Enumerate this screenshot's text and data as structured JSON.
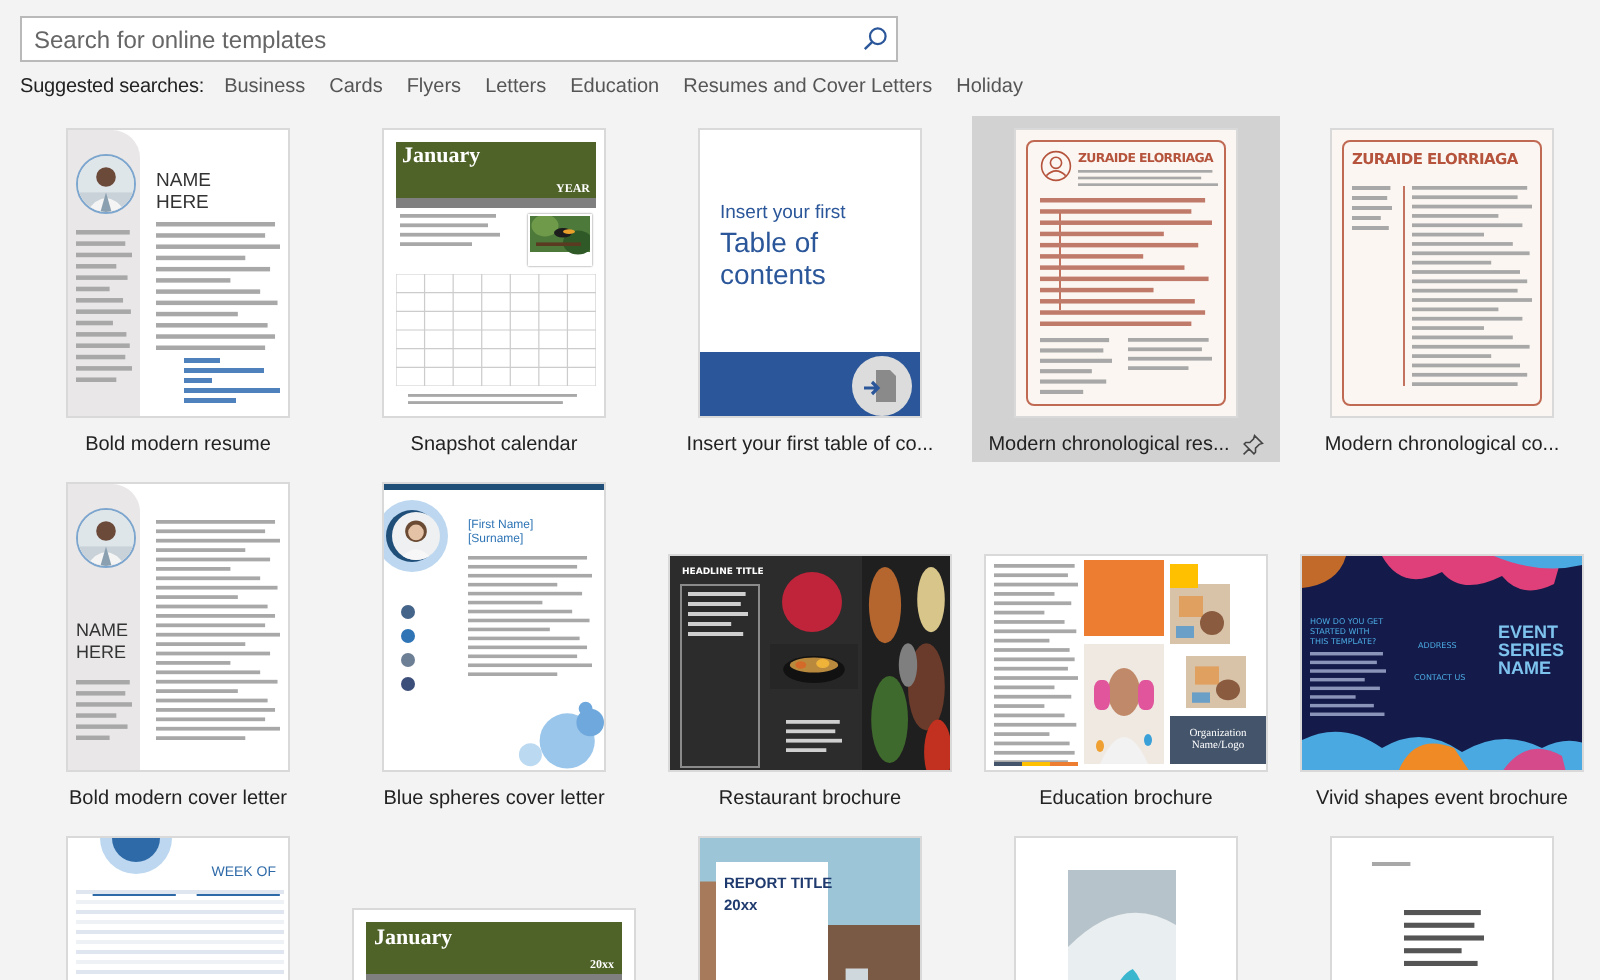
{
  "search": {
    "placeholder": "Search for online templates"
  },
  "suggested": {
    "label": "Suggested searches:",
    "links": [
      "Business",
      "Cards",
      "Flyers",
      "Letters",
      "Education",
      "Resumes and Cover Letters",
      "Holiday"
    ]
  },
  "templates": [
    {
      "kind": "resume",
      "label": "Bold modern resume",
      "selected": false,
      "texts": [
        "NAME HERE"
      ]
    },
    {
      "kind": "calendar",
      "label": "Snapshot calendar",
      "selected": false,
      "texts": [
        "January",
        "YEAR"
      ]
    },
    {
      "kind": "toc",
      "label": "Insert your first table of co...",
      "selected": false,
      "texts": [
        "Insert your first",
        "Table of contents"
      ]
    },
    {
      "kind": "zresume",
      "label": "Modern chronological res...",
      "selected": true,
      "texts": [
        "ZURAIDE ELORRIAGA"
      ]
    },
    {
      "kind": "zletter",
      "label": "Modern chronological co...",
      "selected": false,
      "texts": [
        "ZURAIDE ELORRIAGA"
      ]
    },
    {
      "kind": "coverletter",
      "label": "Bold modern cover letter",
      "selected": false,
      "texts": [
        "NAME HERE"
      ]
    },
    {
      "kind": "spheres",
      "label": "Blue spheres cover letter",
      "selected": false,
      "texts": [
        "[First Name] [Surname]"
      ]
    },
    {
      "kind": "restaurant",
      "label": "Restaurant brochure",
      "selected": false,
      "texts": [
        "HEADLINE TITLE"
      ]
    },
    {
      "kind": "education",
      "label": "Education brochure",
      "selected": false,
      "texts": [
        "Organization Name/Logo"
      ]
    },
    {
      "kind": "vivid",
      "label": "Vivid shapes event brochure",
      "selected": false,
      "texts": [
        "HOW DO YOU GET STARTED WITH THIS TEMPLATE?",
        "ADDRESS",
        "CONTACT US",
        "EVENT SERIES NAME"
      ]
    },
    {
      "kind": "weekly",
      "selected": false,
      "texts": [
        "WEEK OF"
      ]
    },
    {
      "kind": "calland",
      "selected": false,
      "texts": [
        "January",
        "20xx"
      ]
    },
    {
      "kind": "report",
      "selected": false,
      "texts": [
        "REPORT TITLE",
        "20xx"
      ]
    },
    {
      "kind": "photodoc",
      "selected": false
    },
    {
      "kind": "plaindoc",
      "selected": false
    }
  ]
}
